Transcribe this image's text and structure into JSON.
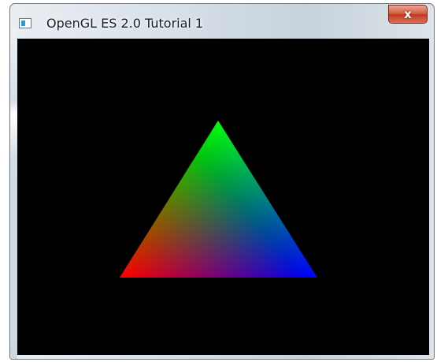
{
  "window": {
    "title": "OpenGL ES 2.0 Tutorial 1",
    "icon": "application-window-icon",
    "close_label": "x"
  },
  "canvas": {
    "background": "#000000",
    "triangle": {
      "vertex_colors": {
        "top": "#00ff00",
        "bottom_left": "#ff0000",
        "bottom_right": "#0000ff"
      }
    }
  }
}
